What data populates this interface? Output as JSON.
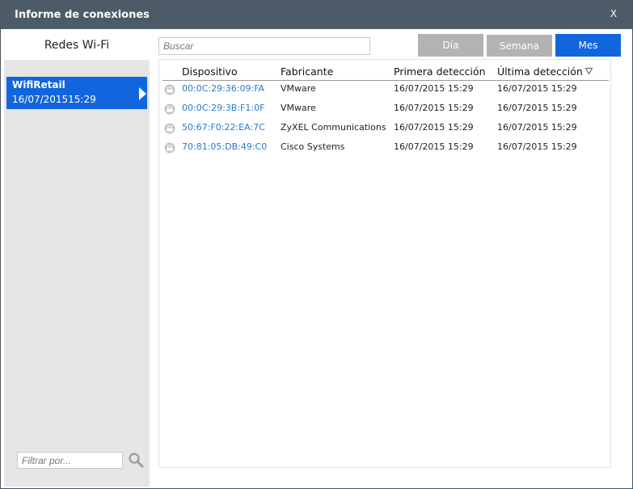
{
  "window": {
    "title": "Informe de conexiones",
    "close_label": "X"
  },
  "sidebar": {
    "header": "Redes Wi-Fi",
    "networks": [
      {
        "name": "WifiRetail",
        "date": "16/07/201515:29",
        "selected": true
      }
    ],
    "filter_placeholder": "Filtrar por..."
  },
  "toolbar": {
    "search_placeholder": "Buscar",
    "periods": [
      {
        "label": "Día",
        "active": false
      },
      {
        "label": "Semana",
        "active": false
      },
      {
        "label": "Mes",
        "active": true
      }
    ]
  },
  "table": {
    "columns": [
      "Dispositivo",
      "Fabricante",
      "Primera detección",
      "Última detección"
    ],
    "sorted_column": "Última detección",
    "rows": [
      {
        "device": "00:0C:29:36:09:FA",
        "manufacturer": "VMware",
        "first": "16/07/2015 15:29",
        "last": "16/07/2015 15:29"
      },
      {
        "device": "00:0C:29:3B:F1:0F",
        "manufacturer": "VMware",
        "first": "16/07/2015 15:29",
        "last": "16/07/2015 15:29"
      },
      {
        "device": "50:67:F0:22:EA:7C",
        "manufacturer": "ZyXEL Communications",
        "first": "16/07/2015 15:29",
        "last": "16/07/2015 15:29"
      },
      {
        "device": "70:81:05:DB:49:C0",
        "manufacturer": "Cisco Systems",
        "first": "16/07/2015 15:29",
        "last": "16/07/2015 15:29"
      }
    ]
  },
  "colors": {
    "titlebar": "#4d5b68",
    "accent": "#1166dd",
    "inactive_button": "#b3b3b3",
    "link": "#2a7ac8",
    "sidebar_bg": "#e6e6e6"
  },
  "icons": {
    "close": "close-icon",
    "search": "magnifier-icon",
    "device": "device-icon",
    "sort": "sort-descending-icon",
    "selection": "arrow-right-icon"
  }
}
